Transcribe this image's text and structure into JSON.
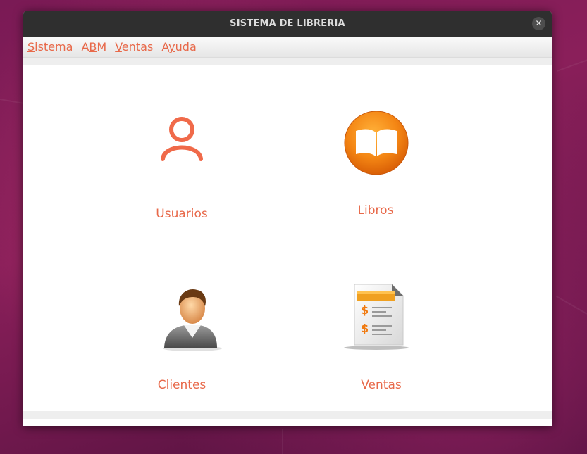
{
  "window": {
    "title": "SISTEMA DE LIBRERIA",
    "minimize_glyph": "–",
    "close_glyph": "✕"
  },
  "menubar": {
    "items": [
      {
        "label_before": "",
        "mnemonic": "S",
        "label_after": "istema"
      },
      {
        "label_before": "A",
        "mnemonic": "B",
        "label_after": "M"
      },
      {
        "label_before": "",
        "mnemonic": "V",
        "label_after": "entas"
      },
      {
        "label_before": "A",
        "mnemonic": "y",
        "label_after": "uda"
      }
    ]
  },
  "tiles": {
    "usuarios": {
      "label": "Usuarios",
      "icon": "user-outline-icon"
    },
    "libros": {
      "label": "Libros",
      "icon": "book-icon"
    },
    "clientes": {
      "label": "Clientes",
      "icon": "person-avatar-icon"
    },
    "ventas": {
      "label": "Ventas",
      "icon": "invoice-icon"
    }
  },
  "colors": {
    "accent": "#e8694a",
    "titlebar": "#2f2f2f",
    "book_orange": "#f07a10"
  }
}
